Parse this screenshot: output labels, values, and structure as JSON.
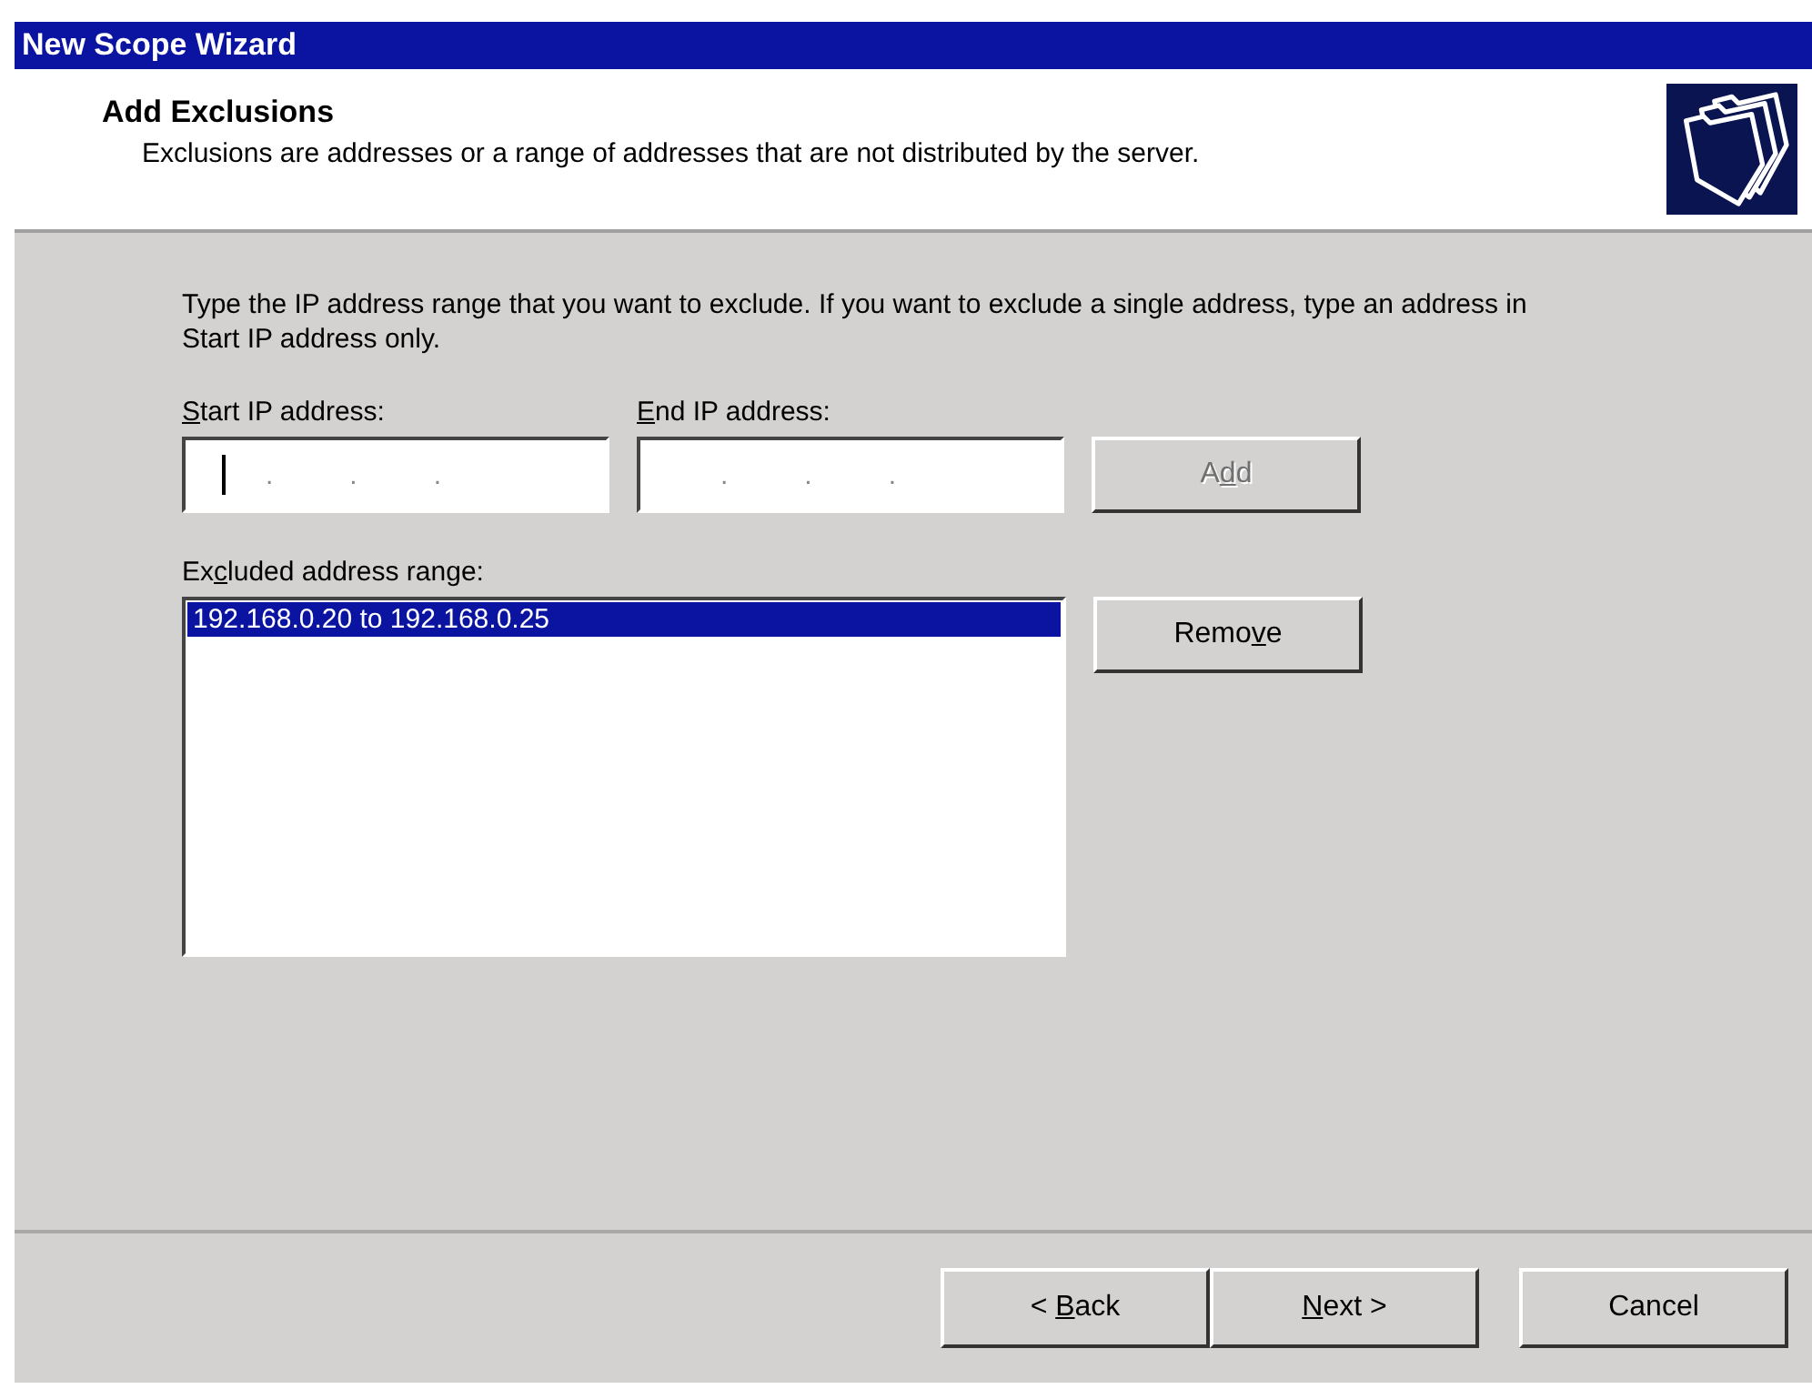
{
  "window": {
    "title": "New Scope Wizard"
  },
  "header": {
    "title": "Add Exclusions",
    "subtitle": "Exclusions are addresses or a range of addresses that are not distributed by the server."
  },
  "instructions": "Type the IP address range that you want to exclude. If you want to exclude a single address, type an address in Start IP address only.",
  "ip_fields": [
    {
      "label": {
        "key": "S",
        "post": "tart IP address:"
      },
      "separators": [
        ".",
        ".",
        "."
      ],
      "focused": true
    },
    {
      "label": {
        "key": "E",
        "post": "nd IP address:"
      },
      "separators": [
        ".",
        ".",
        "."
      ],
      "focused": false
    }
  ],
  "add_button": {
    "label": {
      "pre": "A",
      "key": "d",
      "post": "d"
    },
    "disabled": true
  },
  "excluded": {
    "label": {
      "pre": "Ex",
      "key": "c",
      "post": "luded address range:"
    },
    "items": [
      {
        "text": "192.168.0.20 to 192.168.0.25",
        "selected": true
      }
    ]
  },
  "remove_button": {
    "label": {
      "pre": "Remo",
      "key": "v",
      "post": "e"
    },
    "disabled": false
  },
  "footer_buttons": [
    {
      "label": {
        "pre": "< ",
        "key": "B",
        "post": "ack"
      },
      "disabled": false
    },
    {
      "label": {
        "key": "N",
        "post": "ext >"
      },
      "disabled": false
    },
    {
      "label": {
        "pre": "Cancel"
      },
      "disabled": false
    }
  ]
}
